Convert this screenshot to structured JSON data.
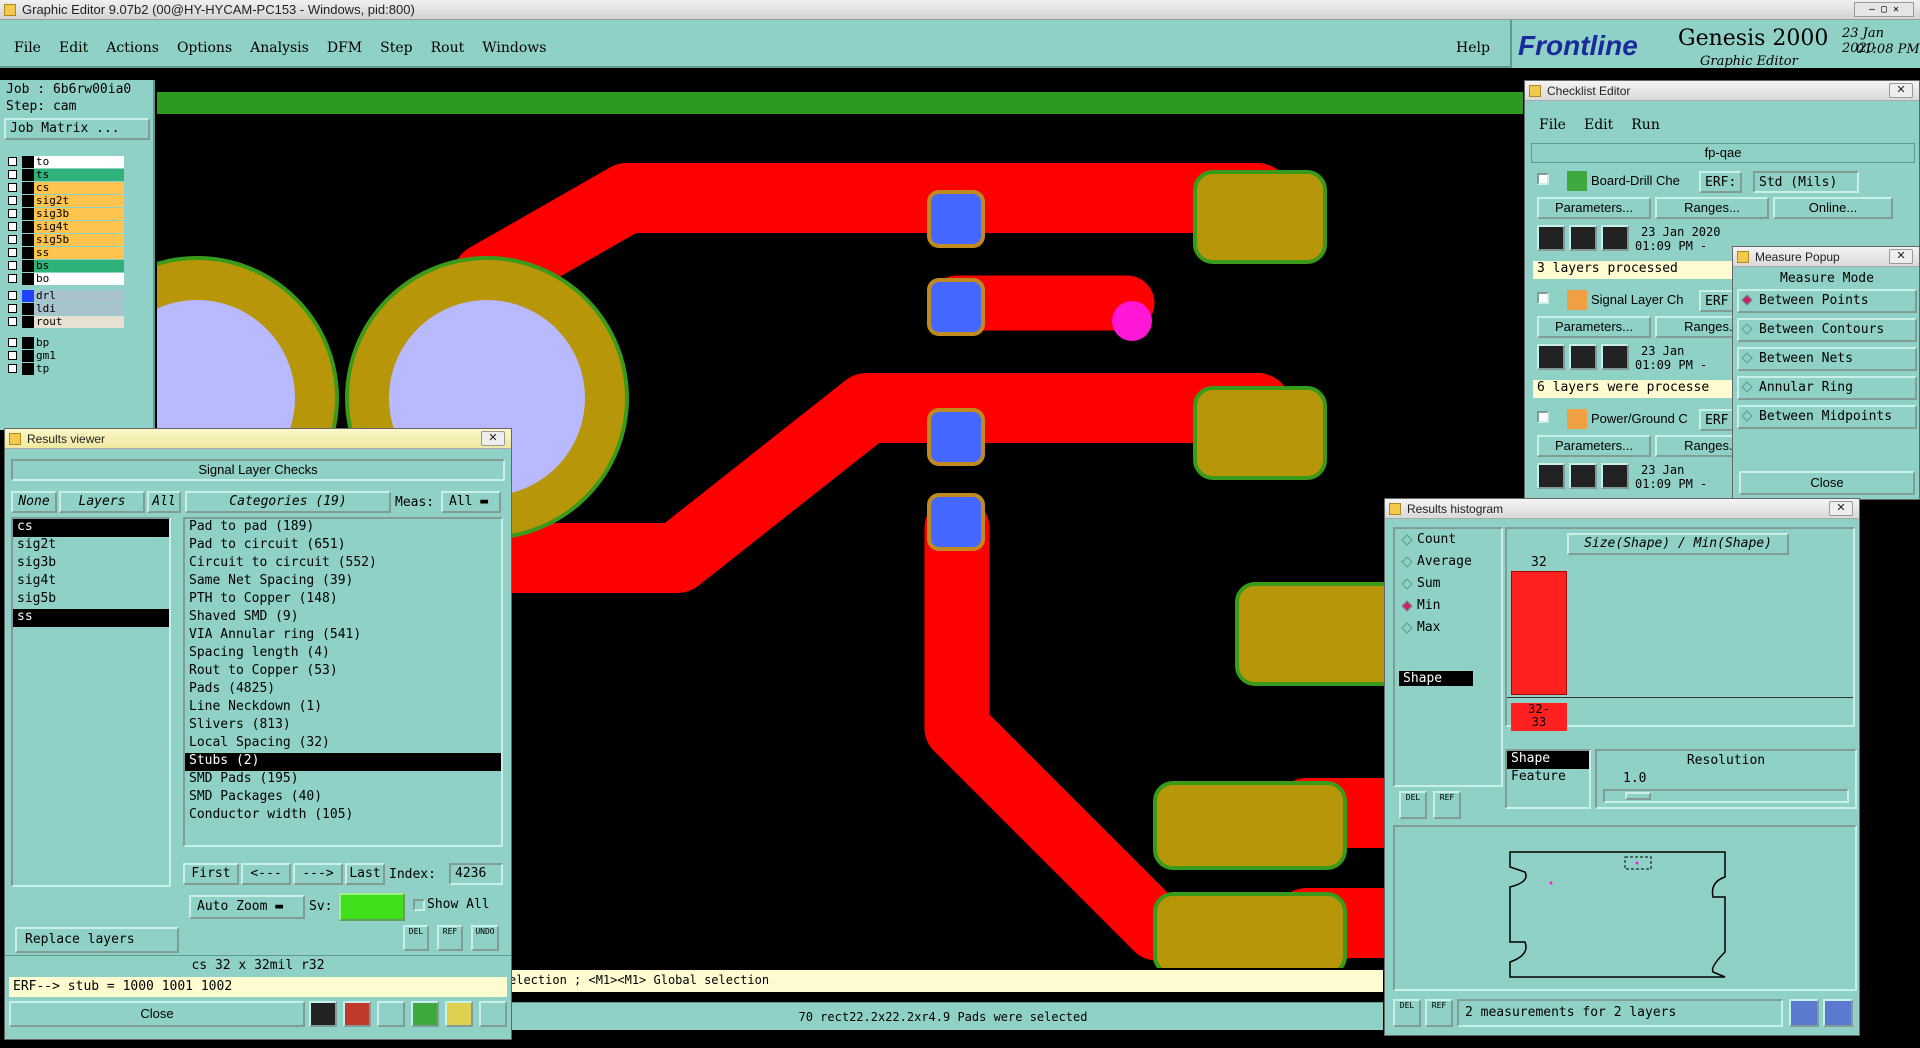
{
  "app_title": "Graphic Editor 9.07b2 (00@HY-HYCAM-PC153 - Windows, pid:800)",
  "menu": [
    "File",
    "Edit",
    "Actions",
    "Options",
    "Analysis",
    "DFM",
    "Step",
    "Rout",
    "Windows"
  ],
  "help": "Help",
  "brand": {
    "logo": "Frontline",
    "product": "Genesis 2000",
    "subtitle": "Graphic Editor",
    "date": "23 Jan 2020",
    "time": "01:08 PM"
  },
  "job": {
    "job": "Job : 6b6rw00ia0",
    "step": "Step: cam",
    "matrix_button": "Job Matrix ..."
  },
  "layers": [
    {
      "name": "to",
      "color": "#ffffff"
    },
    {
      "name": "ts",
      "color": "#2fb27a"
    },
    {
      "name": "cs",
      "color": "#ffc44d"
    },
    {
      "name": "sig2t",
      "color": "#ffc44d"
    },
    {
      "name": "sig3b",
      "color": "#ffc44d"
    },
    {
      "name": "sig4t",
      "color": "#ffc44d"
    },
    {
      "name": "sig5b",
      "color": "#ffc44d"
    },
    {
      "name": "ss",
      "color": "#ffc44d"
    },
    {
      "name": "bs",
      "color": "#2fb27a"
    },
    {
      "name": "bo",
      "color": "#ffffff"
    },
    {
      "name": "drl",
      "color": "#a9c3cc"
    },
    {
      "name": "ldi",
      "color": "#a9c3cc"
    },
    {
      "name": "rout",
      "color": "#e8e0d0"
    },
    {
      "name": "bp",
      "color": "#8fd1c7"
    },
    {
      "name": "gm1",
      "color": "#8fd1c7"
    },
    {
      "name": "tp",
      "color": "#8fd1c7"
    }
  ],
  "results_viewer": {
    "title": "Results viewer",
    "header": "Signal Layer Checks",
    "none": "None",
    "layers": "Layers",
    "all": "All",
    "categories_label": "Categories (19)",
    "meas_label": "Meas:",
    "meas_value": "All",
    "layer_list": [
      "cs",
      "sig2t",
      "sig3b",
      "sig4t",
      "sig5b",
      "ss"
    ],
    "categories": [
      "Pad to pad (189)",
      "Pad to circuit (651)",
      "Circuit to circuit (552)",
      "Same Net Spacing (39)",
      "PTH to Copper (148)",
      "Shaved SMD (9)",
      "VIA Annular ring (541)",
      "Spacing length (4)",
      "Rout to Copper (53)",
      "Pads (4825)",
      "Line Neckdown (1)",
      "Slivers (813)",
      "Local Spacing (32)",
      "Stubs (2)",
      "SMD Pads (195)",
      "SMD Packages (40)",
      "Conductor width (105)"
    ],
    "first": "First",
    "prev": "<---",
    "next": "--->",
    "last": "Last",
    "index_label": "Index:",
    "index_value": "4236",
    "auto_zoom": "Auto Zoom",
    "sv": "Sv:",
    "show_all": "Show All",
    "replace_layers": "Replace layers",
    "info": "cs 32 x 32mil  r32",
    "erf": "ERF--> stub = 1000 1001 1002",
    "close": "Close",
    "del": "DEL",
    "ref": "REF",
    "undo": "UNDO"
  },
  "status": {
    "selection": "election ; <M1><M1> Global selection",
    "bottom": "70 rect22.2x22.2xr4.9 Pads were selected"
  },
  "checklist": {
    "title": "Checklist Editor",
    "menu": [
      "File",
      "Edit",
      "Run"
    ],
    "name": "fp-qae",
    "erf": "ERF:",
    "std": "Std (Mils)",
    "checks": [
      {
        "name": "Board-Drill Che",
        "date": "23 Jan 2020",
        "time": "01:09 PM -",
        "msg": "3 layers processed"
      },
      {
        "name": "Signal Layer Ch",
        "date": "23 Jan",
        "time": "01:09 PM -",
        "msg": "6 layers were processe"
      },
      {
        "name": "Power/Ground C",
        "date": "23 Jan",
        "time": "01:09 PM -",
        "msg": ""
      }
    ],
    "params": "Parameters...",
    "ranges": "Ranges...",
    "online": "Online...",
    "erf_short": "ERF"
  },
  "measure": {
    "title": "Measure Popup",
    "header": "Measure Mode",
    "modes": [
      "Between Points",
      "Between Contours",
      "Between Nets",
      "Annular Ring",
      "Between Midpoints"
    ],
    "selected": 0,
    "close": "Close"
  },
  "histogram": {
    "title": "Results histogram",
    "modes": [
      "Count",
      "Average",
      "Sum",
      "Min",
      "Max"
    ],
    "selected": 3,
    "chart_title": "Size(Shape) / Min(Shape)",
    "list": [
      "Shape"
    ],
    "bar_value": "32",
    "bar_label": "32-\n33",
    "group_list": [
      "Shape",
      "Feature"
    ],
    "resolution_label": "Resolution",
    "resolution_value": "1.0",
    "measurements": "2 measurements for 2 layers"
  }
}
